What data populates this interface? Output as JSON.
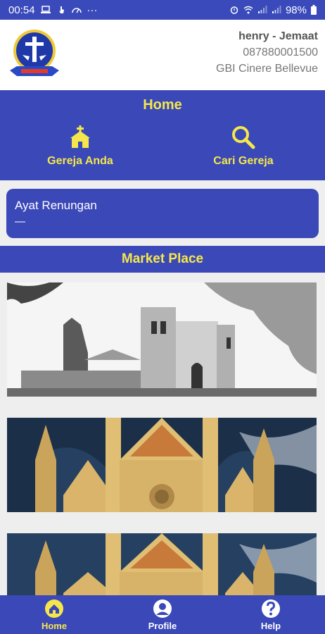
{
  "status_bar": {
    "time": "00:54",
    "notification_icons": [
      "laptop-icon",
      "touch-icon",
      "speed-icon"
    ],
    "more": "···",
    "battery": "98%"
  },
  "header": {
    "user_name": "henry - Jemaat",
    "user_phone": "087880001500",
    "user_church": "GBI Cinere Bellevue",
    "logo_alt": "GBI logo"
  },
  "home": {
    "title": "Home",
    "gereja_anda": "Gereja Anda",
    "cari_gereja": "Cari Gereja"
  },
  "ayat": {
    "title": "Ayat Renungan",
    "text": "—"
  },
  "market": {
    "title": "Market Place"
  },
  "nav": {
    "home": "Home",
    "profile": "Profile",
    "help": "Help"
  },
  "colors": {
    "primary": "#3a48b8",
    "accent": "#f5e74b",
    "white": "#ffffff"
  }
}
